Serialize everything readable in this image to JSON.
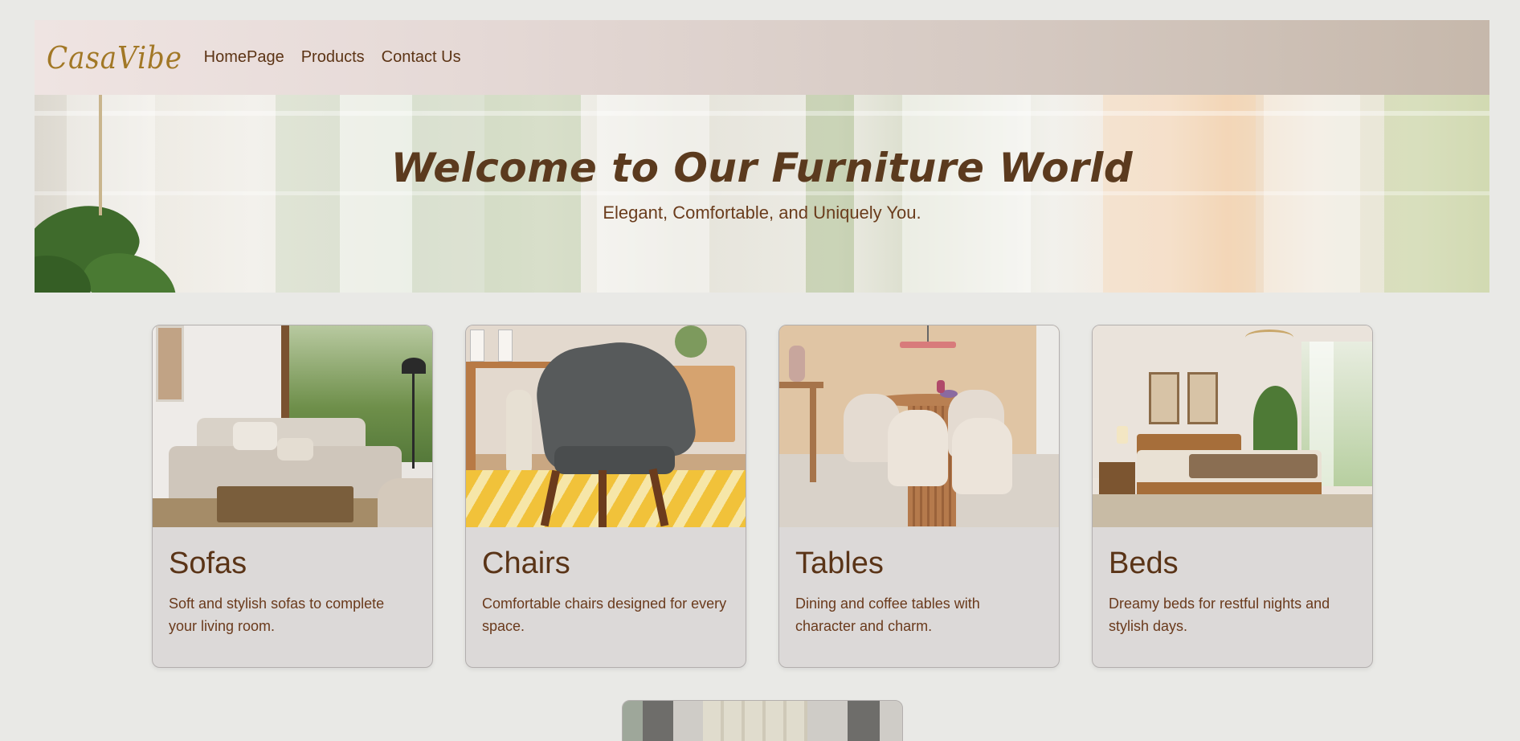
{
  "brand": {
    "logo": "CasaVibe"
  },
  "nav": {
    "items": [
      {
        "label": "HomePage"
      },
      {
        "label": "Products"
      },
      {
        "label": "Contact Us"
      }
    ]
  },
  "hero": {
    "title": "Welcome to Our Furniture World",
    "subtitle": "Elegant, Comfortable, and Uniquely You."
  },
  "products": [
    {
      "title": "Sofas",
      "description": "Soft and stylish sofas to complete your living room."
    },
    {
      "title": "Chairs",
      "description": "Comfortable chairs designed for every space."
    },
    {
      "title": "Tables",
      "description": "Dining and coffee tables with character and charm."
    },
    {
      "title": "Beds",
      "description": "Dreamy beds for restful nights and stylish days."
    }
  ],
  "colors": {
    "background": "#e9e9e6",
    "logo": "#a27826",
    "text_brown": "#5a3417",
    "card_bg": "#dcd9d8"
  }
}
